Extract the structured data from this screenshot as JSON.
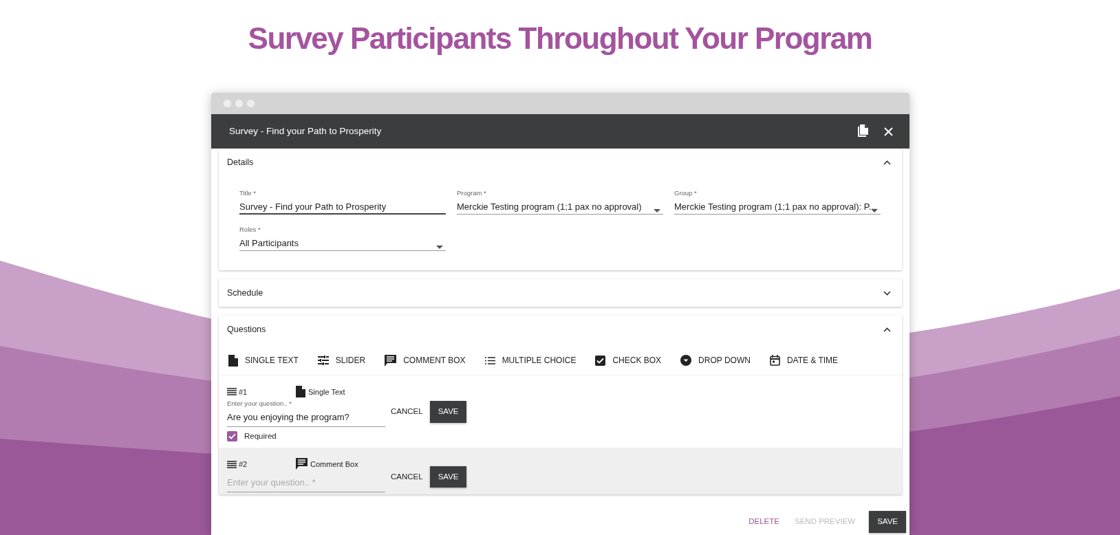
{
  "page_title": "Survey Participants Throughout Your Program",
  "window": {
    "title": "Survey - Find your Path to Prosperity"
  },
  "sections": [
    {
      "title": "Details",
      "expanded": true,
      "fields": [
        {
          "label": "Title *",
          "value": "Survey - Find your Path to Prosperity",
          "kind": "text",
          "focused": true
        },
        {
          "label": "Program *",
          "value": "Merckie Testing program (1;1 pax no approval)",
          "kind": "select",
          "focused": false
        },
        {
          "label": "Group *",
          "value": "Merckie Testing program (1;1 pax no approval): P...",
          "kind": "select",
          "focused": false
        },
        {
          "label": "Roles *",
          "value": "All Participants",
          "kind": "select",
          "focused": false
        }
      ]
    },
    {
      "title": "Schedule",
      "expanded": false
    },
    {
      "title": "Questions",
      "expanded": true
    }
  ],
  "question_types": [
    {
      "label": "SINGLE TEXT",
      "kind": "document"
    },
    {
      "label": "SLIDER",
      "kind": "slider"
    },
    {
      "label": "COMMENT BOX",
      "kind": "comment"
    },
    {
      "label": "MULTIPLE CHOICE",
      "kind": "list"
    },
    {
      "label": "CHECK BOX",
      "kind": "checkbox"
    },
    {
      "label": "DROP DOWN",
      "kind": "dropdown"
    },
    {
      "label": "DATE & TIME",
      "kind": "calendar"
    }
  ],
  "questions": [
    {
      "number": "#1",
      "type": "Single Text",
      "kind": "document",
      "label": "Enter your question.. *",
      "value": "Are you enjoying the program?",
      "required": {
        "label": "Required",
        "checked": true
      },
      "buttons": [
        "CANCEL",
        "SAVE"
      ],
      "selected": false
    },
    {
      "number": "#2",
      "type": "Comment Box",
      "kind": "comment",
      "placeholder": "Enter your question.. *",
      "buttons": [
        "CANCEL",
        "SAVE"
      ],
      "selected": true
    }
  ],
  "footer_buttons": [
    {
      "label": "DELETE",
      "kind": "link",
      "disabled": false
    },
    {
      "label": "SEND PREVIEW",
      "kind": "link",
      "disabled": true
    },
    {
      "label": "SAVE",
      "kind": "primary",
      "disabled": false
    }
  ]
}
